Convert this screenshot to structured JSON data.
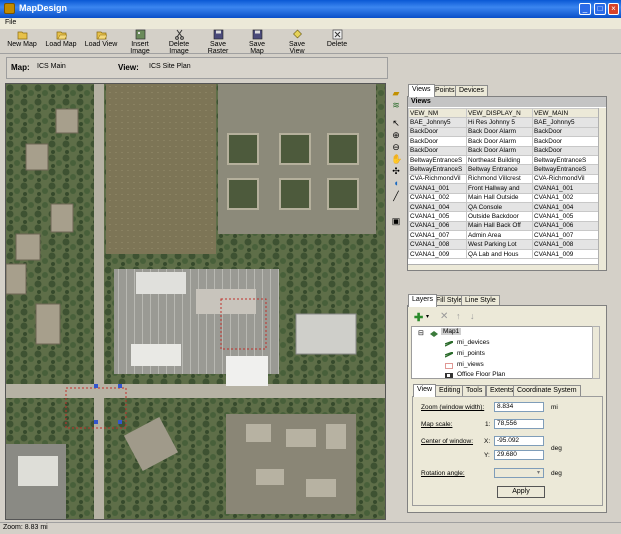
{
  "window": {
    "title": "MapDesign"
  },
  "menu": {
    "file": "File"
  },
  "toolbar": {
    "new_map": "New Map",
    "load_map": "Load Map",
    "load_view": "Load View",
    "insert_image": "Insert Image",
    "delete_image": "Delete Image",
    "save_raster": "Save Raster",
    "save_map": "Save Map",
    "save_view": "Save View",
    "delete": "Delete"
  },
  "info": {
    "map_label": "Map:",
    "map_value": "ICS Main",
    "view_label": "View:",
    "view_value": "ICS Site Plan"
  },
  "status": {
    "zoom": "Zoom: 8.83 mi"
  },
  "top_tabs": [
    "Views",
    "Points",
    "Devices"
  ],
  "views": {
    "header": "Views",
    "columns": [
      "VEW_NM",
      "VEW_DISPLAY_N",
      "VEW_MAIN"
    ],
    "rows": [
      [
        "BAE_Johnny5",
        "Hi Res Johnny 5",
        "BAE_Johnny5"
      ],
      [
        "BackDoor",
        "Back Door Alarm",
        "BackDoor"
      ],
      [
        "BackDoor",
        "Back Door Alarm",
        "BackDoor"
      ],
      [
        "BackDoor",
        "Back Door Alarm",
        "BackDoor"
      ],
      [
        "BeltwayEntranceS",
        "Northeast Building",
        "BeltwayEntranceS"
      ],
      [
        "BeltwayEntranceS",
        "Beltway Entrance",
        "BeltwayEntranceS"
      ],
      [
        "CVA-RichmondVil",
        "Richmond Villcrest",
        "CVA-RichmondVil"
      ],
      [
        "CVANA1_001",
        "Front Hallway and",
        "CVANA1_001"
      ],
      [
        "CVANA1_002",
        "Main Hall Outside",
        "CVANA1_002"
      ],
      [
        "CVANA1_004",
        "QA Console",
        "CVANA1_004"
      ],
      [
        "CVANA1_005",
        "Outside Backdoor",
        "CVANA1_005"
      ],
      [
        "CVANA1_006",
        "Main Hall Back Off",
        "CVANA1_006"
      ],
      [
        "CVANA1_007",
        "Admin Area",
        "CVANA1_007"
      ],
      [
        "CVANA1_008",
        "West Parking Lot",
        "CVANA1_008"
      ],
      [
        "CVANA1_009",
        "QA Lab and Hous",
        "CVANA1_009"
      ]
    ]
  },
  "layer_tabs": [
    "Layers",
    "Fill Style",
    "Line Style"
  ],
  "layers": {
    "root": "Map1",
    "items": [
      "mi_devices",
      "mi_points",
      "mi_views",
      "Office Floor Plan"
    ]
  },
  "prop_tabs": [
    "View",
    "Editing",
    "Tools",
    "Extents",
    "Coordinate System"
  ],
  "view_props": {
    "zoom_label": "Zoom (window width):",
    "zoom_value": "8.834",
    "zoom_unit": "mi",
    "scale_label": "Map scale:",
    "scale_prefix": "1:",
    "scale_value": "78,556",
    "center_label": "Center of window:",
    "x_label": "X:",
    "x_value": "-95.092",
    "y_label": "Y:",
    "y_value": "29.680",
    "deg_unit": "deg",
    "rotation_label": "Rotation angle:",
    "rotation_value": "",
    "rotation_unit": "deg",
    "apply": "Apply"
  },
  "colors": {
    "titlebar": "#0a58d4",
    "selection": "#e4e4e4",
    "chrome": "#d4d0c8"
  }
}
